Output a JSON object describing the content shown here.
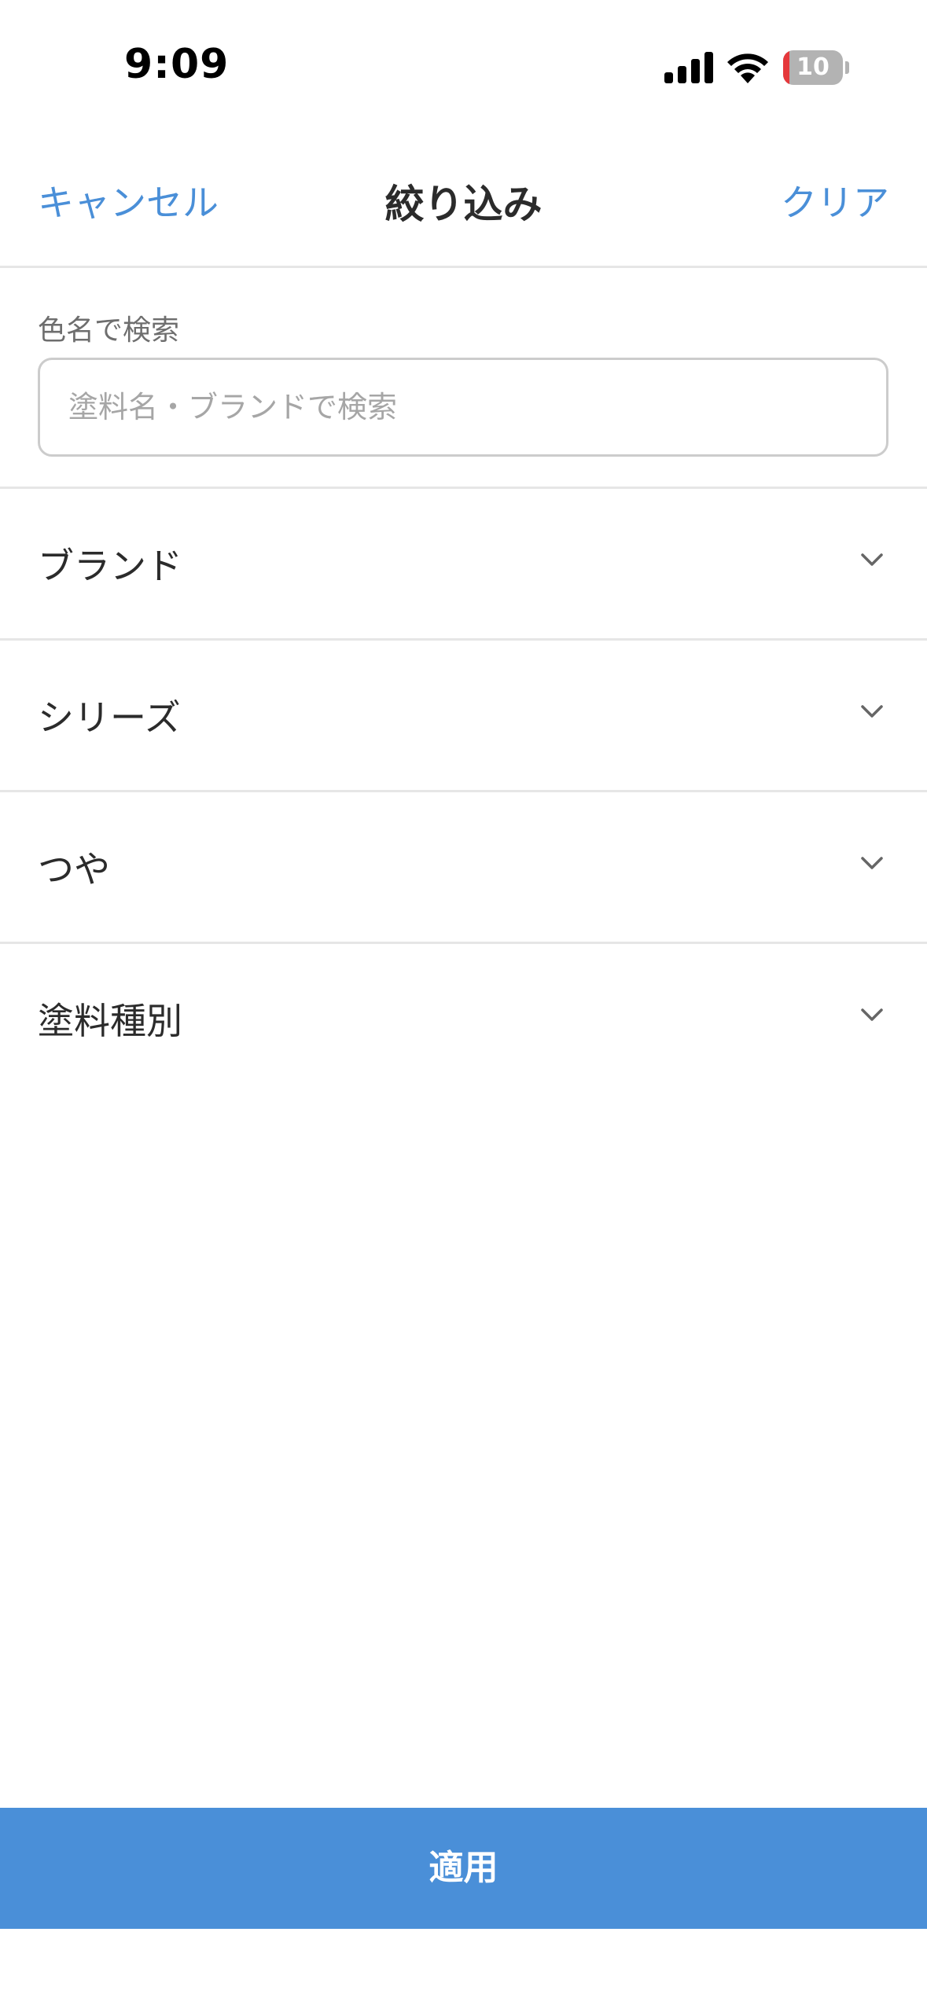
{
  "status_bar": {
    "time": "9:09",
    "battery_text": "10",
    "battery_level": 0.1,
    "battery_low_color": "#e5383b",
    "icons": [
      "signal-icon",
      "wifi-icon",
      "battery-icon"
    ]
  },
  "header": {
    "cancel_label": "キャンセル",
    "title": "絞り込み",
    "clear_label": "クリア",
    "accent_color": "#4a8fd8"
  },
  "search": {
    "label": "色名で検索",
    "placeholder": "塗料名・ブランドで検索",
    "value": ""
  },
  "filters": [
    {
      "label": "ブランド",
      "icon": "chevron-down-icon"
    },
    {
      "label": "シリーズ",
      "icon": "chevron-down-icon"
    },
    {
      "label": "つや",
      "icon": "chevron-down-icon"
    },
    {
      "label": "塗料種別",
      "icon": "chevron-down-icon"
    }
  ],
  "footer": {
    "apply_label": "適用",
    "apply_color": "#4a8fd8"
  }
}
